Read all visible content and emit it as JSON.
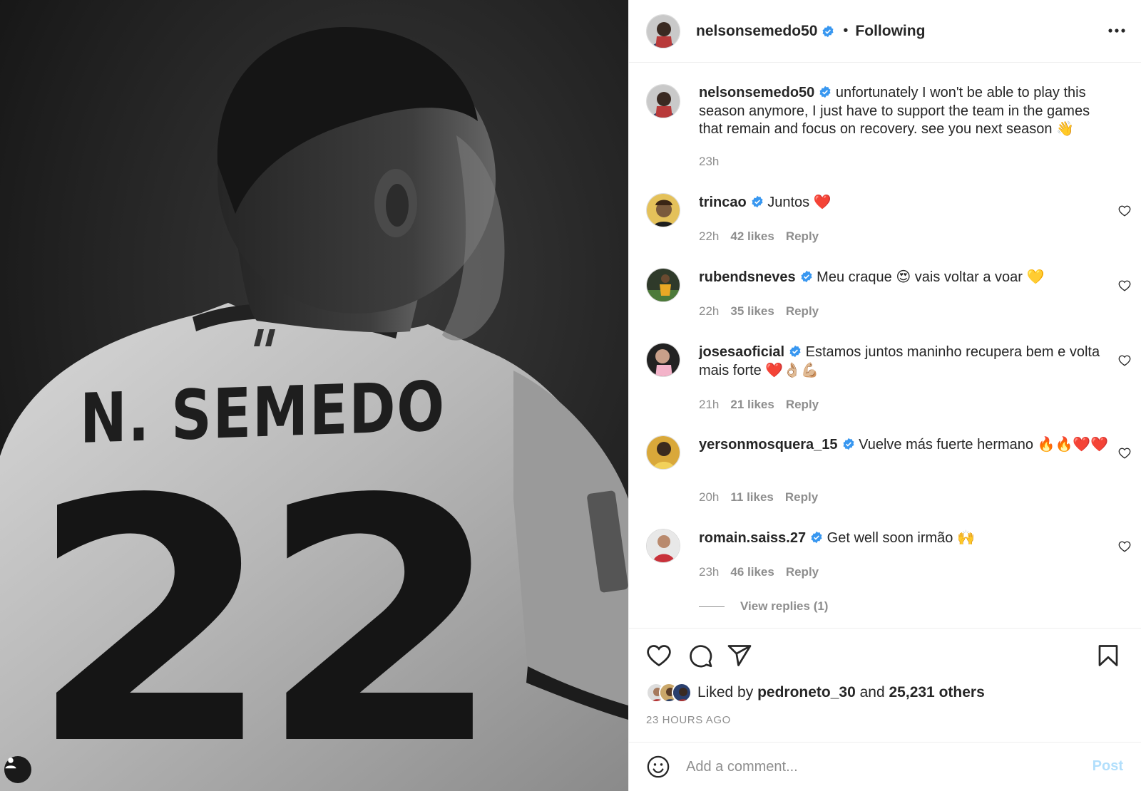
{
  "photo": {
    "jersey_name": "N. SEMEDO",
    "jersey_number": "22",
    "user_tag_icon": "user-icon"
  },
  "header": {
    "username": "nelsonsemedo50",
    "separator": "•",
    "follow_status": "Following",
    "more_icon": "more-horizontal-icon"
  },
  "caption": {
    "username": "nelsonsemedo50",
    "text": "unfortunately I won't be able to play this season anymore, I just have to support the team in the games that remain and focus on recovery. see you next season 👋",
    "time": "23h"
  },
  "comments": [
    {
      "username": "trincao",
      "text": "Juntos ❤️",
      "time": "22h",
      "likes": "42 likes",
      "reply": "Reply"
    },
    {
      "username": "rubendsneves",
      "text": "Meu craque 😍 vais voltar a voar 💛",
      "time": "22h",
      "likes": "35 likes",
      "reply": "Reply"
    },
    {
      "username": "josesaoficial",
      "text": "Estamos juntos maninho recupera bem e volta mais forte ❤️👌🏼💪🏼",
      "time": "21h",
      "likes": "21 likes",
      "reply": "Reply"
    },
    {
      "username": "yersonmosquera_15",
      "text": "Vuelve más fuerte hermano 🔥🔥❤️❤️",
      "time": "20h",
      "likes": "11 likes",
      "reply": "Reply"
    },
    {
      "username": "romain.saiss.27",
      "text": "Get well soon irmão 🙌",
      "time": "23h",
      "likes": "46 likes",
      "reply": "Reply"
    }
  ],
  "view_replies": "View replies (1)",
  "actions": {
    "like_icon": "heart-icon",
    "comment_icon": "comment-icon",
    "share_icon": "send-icon",
    "save_icon": "bookmark-icon"
  },
  "likes": {
    "prefix": "Liked by",
    "user": "pedroneto_30",
    "middle": "and",
    "others": "25,231 others"
  },
  "post_time": "23 HOURS AGO",
  "add_comment": {
    "placeholder": "Add a comment...",
    "post_label": "Post",
    "emoji_icon": "smiley-icon"
  },
  "colors": {
    "verified": "#3897f0",
    "muted": "#8e8e8e",
    "text": "#262626",
    "post_disabled": "#b2dffc",
    "heart_red": "#ed4956"
  }
}
